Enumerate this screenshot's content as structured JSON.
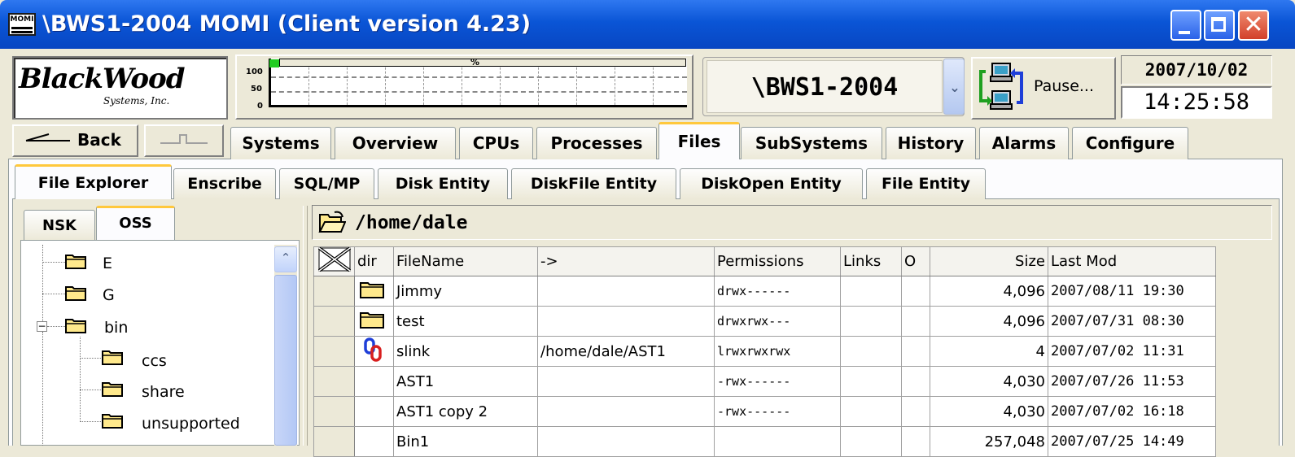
{
  "window": {
    "title": "\\BWS1-2004 MOMI (Client version 4.23)",
    "icon_text": "MOMI"
  },
  "logo": {
    "brand": "BlackWood",
    "brand_first": "Black",
    "brand_second": "Wood",
    "tagline": "Systems, Inc."
  },
  "cpu_graph": {
    "y_ticks": [
      "100",
      "50",
      "0"
    ],
    "label": "%",
    "current_value_pct": 2
  },
  "system": {
    "name": "\\BWS1-2004"
  },
  "pause": {
    "label": "Pause..."
  },
  "clock": {
    "date": "2007/10/02",
    "time": "14:25:58"
  },
  "nav": {
    "back_label": "Back",
    "forward_label": ""
  },
  "main_tabs": [
    {
      "label": "Systems",
      "selected": false
    },
    {
      "label": "Overview",
      "selected": false
    },
    {
      "label": "CPUs",
      "selected": false
    },
    {
      "label": "Processes",
      "selected": false
    },
    {
      "label": "Files",
      "selected": true
    },
    {
      "label": "SubSystems",
      "selected": false
    },
    {
      "label": "History",
      "selected": false
    },
    {
      "label": "Alarms",
      "selected": false
    },
    {
      "label": "Configure",
      "selected": false
    }
  ],
  "sub_tabs": [
    {
      "label": "File Explorer",
      "selected": true
    },
    {
      "label": "Enscribe",
      "selected": false
    },
    {
      "label": "SQL/MP",
      "selected": false
    },
    {
      "label": "Disk Entity",
      "selected": false
    },
    {
      "label": "DiskFile Entity",
      "selected": false
    },
    {
      "label": "DiskOpen Entity",
      "selected": false
    },
    {
      "label": "File Entity",
      "selected": false
    }
  ],
  "fs_tabs": [
    {
      "label": "NSK",
      "selected": false
    },
    {
      "label": "OSS",
      "selected": true
    }
  ],
  "tree": [
    {
      "label": "E",
      "depth": 0
    },
    {
      "label": "G",
      "depth": 0
    },
    {
      "label": "bin",
      "depth": 0,
      "expanded": true
    },
    {
      "label": "ccs",
      "depth": 1
    },
    {
      "label": "share",
      "depth": 1
    },
    {
      "label": "unsupported",
      "depth": 1
    }
  ],
  "path": {
    "current": "/home/dale"
  },
  "grid": {
    "columns": [
      "dir",
      "FileName",
      "->",
      "Permissions",
      "Links",
      "O",
      "Size",
      "Last Mod"
    ],
    "rows": [
      {
        "type": "folder",
        "name": "Jimmy",
        "target": "",
        "perm": "drwx------",
        "links": "",
        "o": "",
        "size": "4,096",
        "mod": "2007/08/11 19:30"
      },
      {
        "type": "folder",
        "name": "test",
        "target": "",
        "perm": "drwxrwx---",
        "links": "",
        "o": "",
        "size": "4,096",
        "mod": "2007/07/31 08:30"
      },
      {
        "type": "link",
        "name": "slink",
        "target": "/home/dale/AST1",
        "perm": "lrwxrwxrwx",
        "links": "",
        "o": "",
        "size": "4",
        "mod": "2007/07/02 11:31"
      },
      {
        "type": "file",
        "name": "AST1",
        "target": "",
        "perm": "-rwx------",
        "links": "",
        "o": "",
        "size": "4,030",
        "mod": "2007/07/26 11:53"
      },
      {
        "type": "file",
        "name": "AST1 copy 2",
        "target": "",
        "perm": "-rwx------",
        "links": "",
        "o": "",
        "size": "4,030",
        "mod": "2007/07/02 16:18"
      },
      {
        "type": "file",
        "name": "Bin1",
        "target": "",
        "perm": "",
        "links": "",
        "o": "",
        "size": "257,048",
        "mod": "2007/07/25 14:49"
      }
    ]
  },
  "colors": {
    "titlebar": "#0a55d6",
    "tab_highlight": "#ffc83c",
    "folder": "#ffe98c",
    "link_blue": "#1f3fd8",
    "link_red": "#d81f1f"
  }
}
